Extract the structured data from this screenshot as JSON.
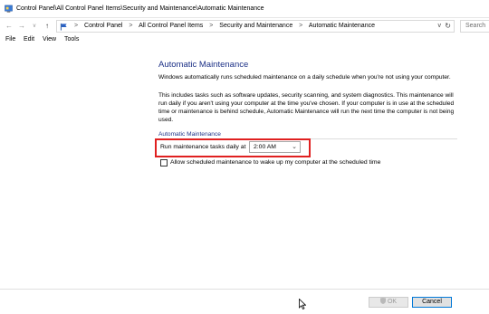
{
  "window": {
    "title": "Control Panel\\All Control Panel Items\\Security and Maintenance\\Automatic Maintenance"
  },
  "nav": {
    "back_icon": "back-arrow-icon",
    "forward_icon": "forward-arrow-icon",
    "recent_icon": "chevron-down-icon",
    "up_icon": "up-arrow-icon"
  },
  "address": {
    "crumbs": [
      "Control Panel",
      "All Control Panel Items",
      "Security and Maintenance",
      "Automatic Maintenance"
    ],
    "separator": ">",
    "dropdown_glyph": "v",
    "refresh_glyph": "↻"
  },
  "search": {
    "placeholder": "Search"
  },
  "menu": {
    "items": [
      "File",
      "Edit",
      "View",
      "Tools"
    ]
  },
  "main": {
    "heading": "Automatic Maintenance",
    "paragraph1": "Windows automatically runs scheduled maintenance on a daily schedule when you're not using your computer.",
    "paragraph2": "This includes tasks such as software updates, security scanning, and system diagnostics. This maintenance will run daily if you aren't using your computer at the time you've chosen. If your computer is in use at the scheduled time or maintenance is behind schedule, Automatic Maintenance will run the next time the computer is not being used.",
    "section_title": "Automatic Maintenance",
    "run_label": "Run maintenance tasks daily at",
    "time_value": "2:00 AM",
    "wake_label": "Allow scheduled maintenance to wake up my computer at the scheduled time",
    "wake_checked": false
  },
  "footer": {
    "ok_label": "OK",
    "cancel_label": "Cancel"
  },
  "colors": {
    "heading": "#1e3287",
    "highlight": "#e02020",
    "cancel_border": "#0078d7"
  }
}
